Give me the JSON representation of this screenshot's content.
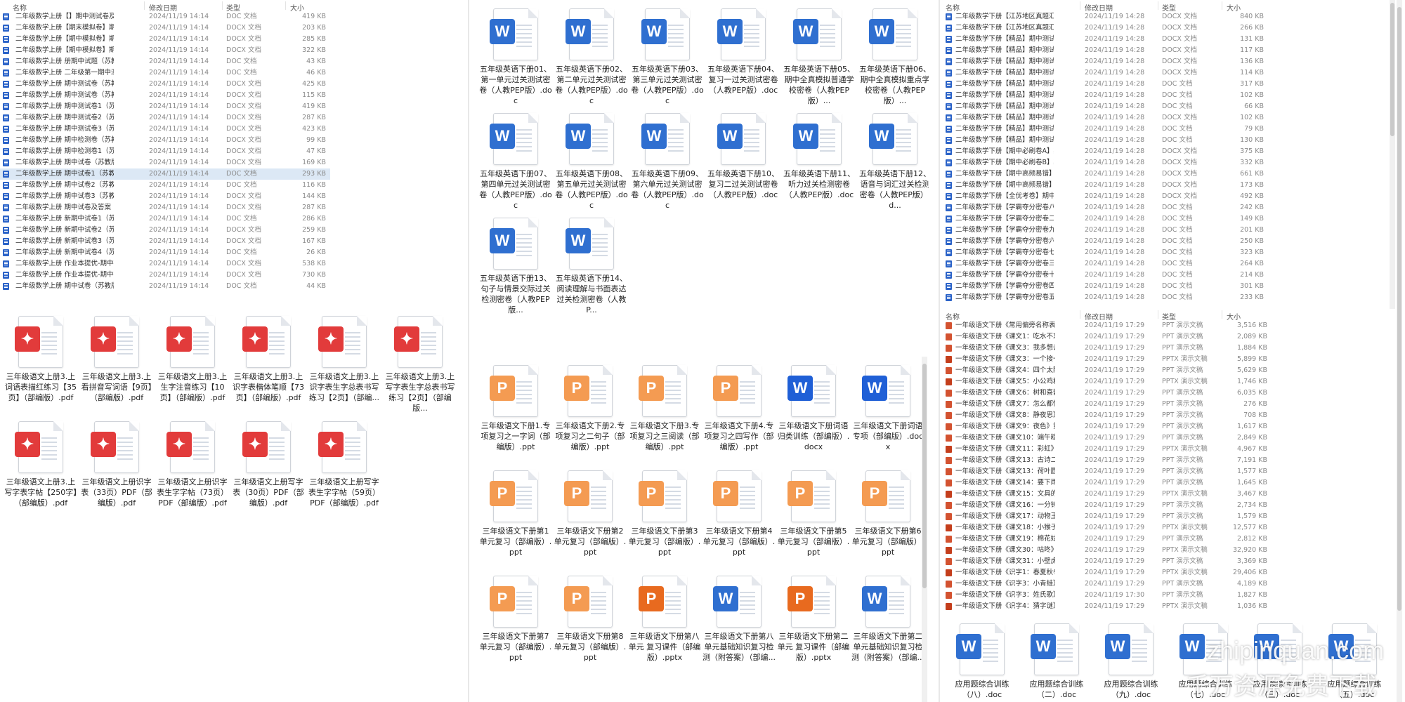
{
  "columns": {
    "name": "名称",
    "date": "修改日期",
    "type": "类型",
    "size": "大小"
  },
  "list1": [
    {
      "name": "二年级数学上册【】期中测试卷及答...",
      "date": "2024/11/19 14:14",
      "type": "DOC 文档",
      "size": "419 KB",
      "icon": "word"
    },
    {
      "name": "二年级数学上册【期末模拟卷】期中...",
      "date": "2024/11/19 14:14",
      "type": "DOCX 文档",
      "size": "203 KB",
      "icon": "word"
    },
    {
      "name": "二年级数学上册【期中模拟卷】期中...",
      "date": "2024/11/19 14:14",
      "type": "DOCX 文档",
      "size": "285 KB",
      "icon": "word"
    },
    {
      "name": "二年级数学上册【期中模拟卷】期中...",
      "date": "2024/11/19 14:14",
      "type": "DOCX 文档",
      "size": "322 KB",
      "icon": "word"
    },
    {
      "name": "二年级数学上册 册期中试题（苏教版...",
      "date": "2024/11/19 14:14",
      "type": "DOC 文档",
      "size": "43 KB",
      "icon": "word"
    },
    {
      "name": "二年级数学上册 二年级第一期中测试...",
      "date": "2024/11/19 14:14",
      "type": "DOC 文档",
      "size": "46 KB",
      "icon": "word"
    },
    {
      "name": "二年级数学上册 期中测试卷（苏教版...",
      "date": "2024/11/19 14:14",
      "type": "DOCX 文档",
      "size": "425 KB",
      "icon": "word"
    },
    {
      "name": "二年级数学上册 期中测试卷（苏教版...",
      "date": "2024/11/19 14:14",
      "type": "DOCX 文档",
      "size": "115 KB",
      "icon": "word"
    },
    {
      "name": "二年级数学上册 期中测试卷1（苏教版...",
      "date": "2024/11/19 14:14",
      "type": "DOCX 文档",
      "size": "419 KB",
      "icon": "word"
    },
    {
      "name": "二年级数学上册 期中测试卷2（苏教版...",
      "date": "2024/11/19 14:14",
      "type": "DOCX 文档",
      "size": "287 KB",
      "icon": "word"
    },
    {
      "name": "二年级数学上册 期中测试卷3（苏教版...",
      "date": "2024/11/19 14:14",
      "type": "DOCX 文档",
      "size": "423 KB",
      "icon": "word"
    },
    {
      "name": "二年级数学上册 期中检测卷（苏教版...",
      "date": "2024/11/19 14:14",
      "type": "DOCX 文档",
      "size": "99 KB",
      "icon": "word"
    },
    {
      "name": "二年级数学上册 期中检测卷1（苏教版...",
      "date": "2024/11/19 14:14",
      "type": "DOCX 文档",
      "size": "47 KB",
      "icon": "word"
    },
    {
      "name": "二年级数学上册 期中试卷（苏教版）...",
      "date": "2024/11/19 14:14",
      "type": "DOCX 文档",
      "size": "169 KB",
      "icon": "word"
    },
    {
      "name": "二年级数学上册 期中试卷1（苏教版）...",
      "date": "2024/11/19 14:14",
      "type": "DOC 文档",
      "size": "293 KB",
      "icon": "word",
      "selected": true
    },
    {
      "name": "二年级数学上册 期中试卷2（苏教版）...",
      "date": "2024/11/19 14:14",
      "type": "DOC 文档",
      "size": "116 KB",
      "icon": "word"
    },
    {
      "name": "二年级数学上册 期中试卷3（苏教版）...",
      "date": "2024/11/19 14:14",
      "type": "DOCX 文档",
      "size": "144 KB",
      "icon": "word"
    },
    {
      "name": "二年级数学上册 期中试卷及答案（苏...",
      "date": "2024/11/19 14:14",
      "type": "DOCX 文档",
      "size": "287 KB",
      "icon": "word"
    },
    {
      "name": "二年级数学上册 新期中试卷1（苏教版...",
      "date": "2024/11/19 14:14",
      "type": "DOC 文档",
      "size": "286 KB",
      "icon": "word"
    },
    {
      "name": "二年级数学上册 新期中试卷2（苏教版...",
      "date": "2024/11/19 14:14",
      "type": "DOCX 文档",
      "size": "259 KB",
      "icon": "word"
    },
    {
      "name": "二年级数学上册 新期中试卷3（苏教版...",
      "date": "2024/11/19 14:14",
      "type": "DOCX 文档",
      "size": "167 KB",
      "icon": "word"
    },
    {
      "name": "二年级数学上册 新期中试卷4（苏教版...",
      "date": "2024/11/19 14:14",
      "type": "DOC 文档",
      "size": "26 KB",
      "icon": "word"
    },
    {
      "name": "二年级数学上册 作业本提优-期中提优...",
      "date": "2024/11/19 14:14",
      "type": "DOCX 文档",
      "size": "538 KB",
      "icon": "word"
    },
    {
      "name": "二年级数学上册 作业本提优-期中提优...",
      "date": "2024/11/19 14:14",
      "type": "DOCX 文档",
      "size": "730 KB",
      "icon": "word"
    },
    {
      "name": "二年级数学上册 期中试卷（苏教版）.doc",
      "date": "2024/11/19 14:14",
      "type": "DOC 文档",
      "size": "44 KB",
      "icon": "word"
    }
  ],
  "list2": [
    {
      "name": "二年级数学下册【江苏地区真题汇编】...",
      "date": "2024/11/19 14:28",
      "type": "DOCX 文档",
      "size": "840 KB",
      "icon": "word"
    },
    {
      "name": "二年级数学下册【江苏地区真题汇编】...",
      "date": "2024/11/19 14:28",
      "type": "DOCX 文档",
      "size": "266 KB",
      "icon": "word"
    },
    {
      "name": "二年级数学下册【精品】期中测试卷（...",
      "date": "2024/11/19 14:28",
      "type": "DOCX 文档",
      "size": "131 KB",
      "icon": "word"
    },
    {
      "name": "二年级数学下册【精品】期中测试卷（...",
      "date": "2024/11/19 14:28",
      "type": "DOCX 文档",
      "size": "117 KB",
      "icon": "word"
    },
    {
      "name": "二年级数学下册【精品】期中测试卷（...",
      "date": "2024/11/19 14:28",
      "type": "DOCX 文档",
      "size": "136 KB",
      "icon": "word"
    },
    {
      "name": "二年级数学下册【精品】期中测试卷（...",
      "date": "2024/11/19 14:28",
      "type": "DOCX 文档",
      "size": "114 KB",
      "icon": "word"
    },
    {
      "name": "二年级数学下册【精品】期中测试题（...",
      "date": "2024/11/19 14:28",
      "type": "DOC 文档",
      "size": "317 KB",
      "icon": "word"
    },
    {
      "name": "二年级数学下册【精品】期中测试题（...",
      "date": "2024/11/19 14:28",
      "type": "DOC 文档",
      "size": "102 KB",
      "icon": "word"
    },
    {
      "name": "二年级数学下册【精品】期中测试题（...",
      "date": "2024/11/19 14:28",
      "type": "DOC 文档",
      "size": "66 KB",
      "icon": "word"
    },
    {
      "name": "二年级数学下册【精品】期中测试题（...",
      "date": "2024/11/19 14:28",
      "type": "DOCX 文档",
      "size": "102 KB",
      "icon": "word"
    },
    {
      "name": "二年级数学下册【精品】期中测试题（...",
      "date": "2024/11/19 14:28",
      "type": "DOC 文档",
      "size": "79 KB",
      "icon": "word"
    },
    {
      "name": "二年级数学下册【精品】期中测试题（...",
      "date": "2024/11/19 14:28",
      "type": "DOC 文档",
      "size": "130 KB",
      "icon": "word"
    },
    {
      "name": "二年级数学下册【期中必刷卷A】期中...",
      "date": "2024/11/19 14:28",
      "type": "DOCX 文档",
      "size": "375 KB",
      "icon": "word"
    },
    {
      "name": "二年级数学下册【期中必刷卷B】期中...",
      "date": "2024/11/19 14:28",
      "type": "DOCX 文档",
      "size": "332 KB",
      "icon": "word"
    },
    {
      "name": "二年级数学下册【期中高频易错】期中...",
      "date": "2024/11/19 14:28",
      "type": "DOCX 文档",
      "size": "661 KB",
      "icon": "word"
    },
    {
      "name": "二年级数学下册【期中高频易错】期中...",
      "date": "2024/11/19 14:28",
      "type": "DOCX 文档",
      "size": "173 KB",
      "icon": "word"
    },
    {
      "name": "二年级数学下册【全优考卷】期中测评...",
      "date": "2024/11/19 14:28",
      "type": "DOCX 文档",
      "size": "492 KB",
      "icon": "word"
    },
    {
      "name": "二年级数学下册【学霸夺分密卷八】期...",
      "date": "2024/11/19 14:28",
      "type": "DOC 文档",
      "size": "242 KB",
      "icon": "word"
    },
    {
      "name": "二年级数学下册【学霸夺分密卷二】期...",
      "date": "2024/11/19 14:28",
      "type": "DOC 文档",
      "size": "149 KB",
      "icon": "word"
    },
    {
      "name": "二年级数学下册【学霸夺分密卷九】期...",
      "date": "2024/11/19 14:28",
      "type": "DOC 文档",
      "size": "201 KB",
      "icon": "word"
    },
    {
      "name": "二年级数学下册【学霸夺分密卷六】期...",
      "date": "2024/11/19 14:28",
      "type": "DOC 文档",
      "size": "250 KB",
      "icon": "word"
    },
    {
      "name": "二年级数学下册【学霸夺分密卷七】期...",
      "date": "2024/11/19 14:28",
      "type": "DOC 文档",
      "size": "323 KB",
      "icon": "word"
    },
    {
      "name": "二年级数学下册【学霸夺分密卷三】期...",
      "date": "2024/11/19 14:28",
      "type": "DOC 文档",
      "size": "264 KB",
      "icon": "word"
    },
    {
      "name": "二年级数学下册【学霸夺分密卷十】期...",
      "date": "2024/11/19 14:28",
      "type": "DOC 文档",
      "size": "214 KB",
      "icon": "word"
    },
    {
      "name": "二年级数学下册【学霸夺分密卷四】期...",
      "date": "2024/11/19 14:28",
      "type": "DOC 文档",
      "size": "301 KB",
      "icon": "word"
    },
    {
      "name": "二年级数学下册【学霸夺分密卷五】期...",
      "date": "2024/11/19 14:28",
      "type": "DOC 文档",
      "size": "233 KB",
      "icon": "word"
    }
  ],
  "list3": [
    {
      "name": "一年级语文下册《常用偏旁名称表》第...",
      "date": "2024/11/19 17:29",
      "type": "PPT 演示文稿",
      "size": "3,516 KB",
      "icon": "ppt"
    },
    {
      "name": "一年级语文下册《课文1：吃水不忘挖...",
      "date": "2024/11/19 17:29",
      "type": "PPT 演示文稿",
      "size": "2,089 KB",
      "icon": "ppt"
    },
    {
      "name": "一年级语文下册《课文3：我多想去看...",
      "date": "2024/11/19 17:29",
      "type": "PPT 演示文稿",
      "size": "1,884 KB",
      "icon": "ppt"
    },
    {
      "name": "一年级语文下册《课文3：一个接一个...",
      "date": "2024/11/19 17:29",
      "type": "PPTX 演示文稿",
      "size": "5,899 KB",
      "icon": "pptx"
    },
    {
      "name": "一年级语文下册《课文4：四个太阳》...",
      "date": "2024/11/19 17:29",
      "type": "PPT 演示文稿",
      "size": "5,629 KB",
      "icon": "ppt"
    },
    {
      "name": "一年级语文下册《课文5：小公鸡和小...",
      "date": "2024/11/19 17:29",
      "type": "PPTX 演示文稿",
      "size": "1,746 KB",
      "icon": "pptx"
    },
    {
      "name": "一年级语文下册《课文6：树和喜鹊》...",
      "date": "2024/11/19 17:29",
      "type": "PPT 演示文稿",
      "size": "6,035 KB",
      "icon": "ppt"
    },
    {
      "name": "一年级语文下册《课文7：怎么都快乐...",
      "date": "2024/11/19 17:29",
      "type": "PPT 演示文稿",
      "size": "276 KB",
      "icon": "ppt"
    },
    {
      "name": "一年级语文下册《课文8：静夜思》第...",
      "date": "2024/11/19 17:29",
      "type": "PPT 演示文稿",
      "size": "708 KB",
      "icon": "ppt"
    },
    {
      "name": "一年级语文下册《课文9：夜色》第3...",
      "date": "2024/11/19 17:29",
      "type": "PPT 演示文稿",
      "size": "1,617 KB",
      "icon": "ppt"
    },
    {
      "name": "一年级语文下册《课文10：端午粽》...",
      "date": "2024/11/19 17:29",
      "type": "PPT 演示文稿",
      "size": "2,849 KB",
      "icon": "ppt"
    },
    {
      "name": "一年级语文下册《课文11：彩虹》第3...",
      "date": "2024/11/19 17:29",
      "type": "PPTX 演示文稿",
      "size": "4,967 KB",
      "icon": "pptx"
    },
    {
      "name": "一年级语文下册《课文13：古诗二首...",
      "date": "2024/11/19 17:29",
      "type": "PPT 演示文稿",
      "size": "7,191 KB",
      "icon": "ppt"
    },
    {
      "name": "一年级语文下册《课文13：荷叶圆圆》...",
      "date": "2024/11/19 17:29",
      "type": "PPT 演示文稿",
      "size": "1,577 KB",
      "icon": "ppt"
    },
    {
      "name": "一年级语文下册《课文14：要下雨了》...",
      "date": "2024/11/19 17:29",
      "type": "PPT 演示文稿",
      "size": "1,645 KB",
      "icon": "ppt"
    },
    {
      "name": "一年级语文下册《课文15：文具的家》...",
      "date": "2024/11/19 17:29",
      "type": "PPTX 演示文稿",
      "size": "3,467 KB",
      "icon": "pptx"
    },
    {
      "name": "一年级语文下册《课文16：一分钟》...",
      "date": "2024/11/19 17:29",
      "type": "PPT 演示文稿",
      "size": "2,734 KB",
      "icon": "ppt"
    },
    {
      "name": "一年级语文下册《课文17：动物王国开...",
      "date": "2024/11/19 17:29",
      "type": "PPT 演示文稿",
      "size": "1,579 KB",
      "icon": "ppt"
    },
    {
      "name": "一年级语文下册《课文18：小猴子下山...",
      "date": "2024/11/19 17:29",
      "type": "PPTX 演示文稿",
      "size": "12,577 KB",
      "icon": "pptx"
    },
    {
      "name": "一年级语文下册《课文19：棉花姑娘》...",
      "date": "2024/11/19 17:29",
      "type": "PPT 演示文稿",
      "size": "2,812 KB",
      "icon": "ppt"
    },
    {
      "name": "一年级语文下册《课文30：咕咚》第3...",
      "date": "2024/11/19 17:29",
      "type": "PPTX 演示文稿",
      "size": "32,920 KB",
      "icon": "pptx"
    },
    {
      "name": "一年级语文下册《课文31：小壁虎借尾...",
      "date": "2024/11/19 17:29",
      "type": "PPT 演示文稿",
      "size": "3,369 KB",
      "icon": "ppt"
    },
    {
      "name": "一年级语文下册《识字1：春夏秋冬》...",
      "date": "2024/11/19 17:29",
      "type": "PPTX 演示文稿",
      "size": "29,406 KB",
      "icon": "pptx"
    },
    {
      "name": "一年级语文下册《识字3：小青蛙》第...",
      "date": "2024/11/19 17:29",
      "type": "PPT 演示文稿",
      "size": "4,189 KB",
      "icon": "ppt"
    },
    {
      "name": "一年级语文下册《识字3：姓氏歌》第...",
      "date": "2024/11/19 17:30",
      "type": "PPT 演示文稿",
      "size": "1,827 KB",
      "icon": "ppt"
    },
    {
      "name": "一年级语文下册《识字4：猜字谜》第...",
      "date": "2024/11/19 17:29",
      "type": "PPTX 演示文稿",
      "size": "1,036 KB",
      "icon": "pptx"
    }
  ],
  "grid_pdf": [
    {
      "label": "三年级语文上册3.上词语表描红练习【35页】（部编版）.pdf",
      "badge": "pdf"
    },
    {
      "label": "三年级语文上册3.上看拼音写词语【9页】（部编版）.pdf",
      "badge": "pdf"
    },
    {
      "label": "三年级语文上册3.上生字注音练习【10页】（部编版）.pdf",
      "badge": "pdf"
    },
    {
      "label": "三年级语文上册3.上识字表楷体笔顺【73页】（部编版）.pdf",
      "badge": "pdf"
    },
    {
      "label": "三年级语文上册3.上识字表生字总表书写练习【2页】（部编...",
      "badge": "pdf"
    },
    {
      "label": "三年级语文上册3.上写字表生字总表书写练习【2页】（部编版...",
      "badge": "pdf"
    },
    {
      "label": "三年级语文上册3.上写字表字帖【250字】（部编版）.pdf",
      "badge": "pdf"
    },
    {
      "label": "三年级语文上册识字表（33页）PDF（部编版）.pdf",
      "badge": "pdf"
    },
    {
      "label": "三年级语文上册识字表生字字帖（73页）PDF（部编版）.pdf",
      "badge": "pdf"
    },
    {
      "label": "三年级语文上册写字表（30页）PDF（部编版）.pdf",
      "badge": "pdf"
    },
    {
      "label": "三年级语文上册写字表生字字帖（59页）PDF（部编版）.pdf",
      "badge": "pdf"
    }
  ],
  "grid_en": [
    {
      "label": "五年级英语下册01、第一单元过关测试密卷（人教PEP版）.doc",
      "badge": "word"
    },
    {
      "label": "五年级英语下册02、第二单元过关测试密卷（人教PEP版）.doc",
      "badge": "word"
    },
    {
      "label": "五年级英语下册03、第三单元过关测试密卷（人教PEP版）.doc",
      "badge": "word"
    },
    {
      "label": "五年级英语下册04、复习一过关测试密卷（人教PEP版）.doc",
      "badge": "word"
    },
    {
      "label": "五年级英语下册05、期中全真模拟普通学校密卷（人教PEP版）...",
      "badge": "word"
    },
    {
      "label": "五年级英语下册06、期中全真模拟重点学校密卷（人教PEP版）...",
      "badge": "word"
    },
    {
      "label": "五年级英语下册07、第四单元过关测试密卷（人教PEP版）.doc",
      "badge": "word"
    },
    {
      "label": "五年级英语下册08、第五单元过关测试密卷（人教PEP版）.doc",
      "badge": "word"
    },
    {
      "label": "五年级英语下册09、第六单元过关测试密卷（人教PEP版）.doc",
      "badge": "word"
    },
    {
      "label": "五年级英语下册10、复习二过关测试密卷（人教PEP版）.doc",
      "badge": "word"
    },
    {
      "label": "五年级英语下册11、听力过关检测密卷（人教PEP版）.doc",
      "badge": "word"
    },
    {
      "label": "五年级英语下册12、语音与词汇过关检测密卷（人教PEP版）.d...",
      "badge": "word"
    },
    {
      "label": "五年级英语下册13、句子与情景交际过关检测密卷（人教PEP版...",
      "badge": "word"
    },
    {
      "label": "五年级英语下册14、阅读理解与书面表达过关检测密卷（人教P...",
      "badge": "word"
    }
  ],
  "grid_review": [
    {
      "label": "三年级语文下册1.专项复习之一字词（部编版）.ppt",
      "badge": "ppt"
    },
    {
      "label": "三年级语文下册2.专项复习之二句子（部编版）.ppt",
      "badge": "ppt"
    },
    {
      "label": "三年级语文下册3.专项复习之三阅读（部编版）.ppt",
      "badge": "ppt"
    },
    {
      "label": "三年级语文下册4.专项复习之四写作（部编版）.ppt",
      "badge": "ppt"
    },
    {
      "label": "三年级语文下册词语归类训练（部编版）.docx",
      "badge": "docx"
    },
    {
      "label": "三年级语文下册词语专项（部编版）.docx",
      "badge": "docx"
    },
    {
      "label": "三年级语文下册第1单元复习（部编版）.ppt",
      "badge": "ppt"
    },
    {
      "label": "三年级语文下册第2单元复习（部编版）.ppt",
      "badge": "ppt"
    },
    {
      "label": "三年级语文下册第3单元复习（部编版）.ppt",
      "badge": "ppt"
    },
    {
      "label": "三年级语文下册第4单元复习（部编版）.ppt",
      "badge": "ppt"
    },
    {
      "label": "三年级语文下册第5单元复习（部编版）.ppt",
      "badge": "ppt"
    },
    {
      "label": "三年级语文下册第6单元复习（部编版）.ppt",
      "badge": "ppt"
    },
    {
      "label": "三年级语文下册第7单元复习（部编版）.ppt",
      "badge": "ppt"
    },
    {
      "label": "三年级语文下册第8单元复习（部编版）.ppt",
      "badge": "ppt"
    },
    {
      "label": "三年级语文下册第八单元 复习课件（部编版）.pptx",
      "badge": "pptx"
    },
    {
      "label": "三年级语文下册第八单元基础知识复习检测（附答案）（部编...",
      "badge": "word"
    },
    {
      "label": "三年级语文下册第二单元 复习课件（部编版）.pptx",
      "badge": "pptx"
    },
    {
      "label": "三年级语文下册第二单元基础知识复习检测（附答案）（部编...",
      "badge": "word"
    }
  ],
  "grid_app": [
    {
      "label": "应用题综合训练（八）.doc",
      "badge": "word"
    },
    {
      "label": "应用题综合训练（二）.doc",
      "badge": "word"
    },
    {
      "label": "应用题综合训练（九）.doc",
      "badge": "word"
    },
    {
      "label": "应用题综合训练（七）.doc",
      "badge": "word"
    },
    {
      "label": "应用题综合训练（三）.doc",
      "badge": "word"
    },
    {
      "label": "应用题综合训练（五）.doc",
      "badge": "word"
    }
  ],
  "watermark": {
    "line1": "zhipinquan.com",
    "line2": "千万资源免费下载"
  },
  "colors": {
    "word": "#2f6fd0",
    "pdf": "#e23b3b",
    "ppt": "#f49b52",
    "pptx": "#e86a1f",
    "selected": "#dce8f5"
  }
}
